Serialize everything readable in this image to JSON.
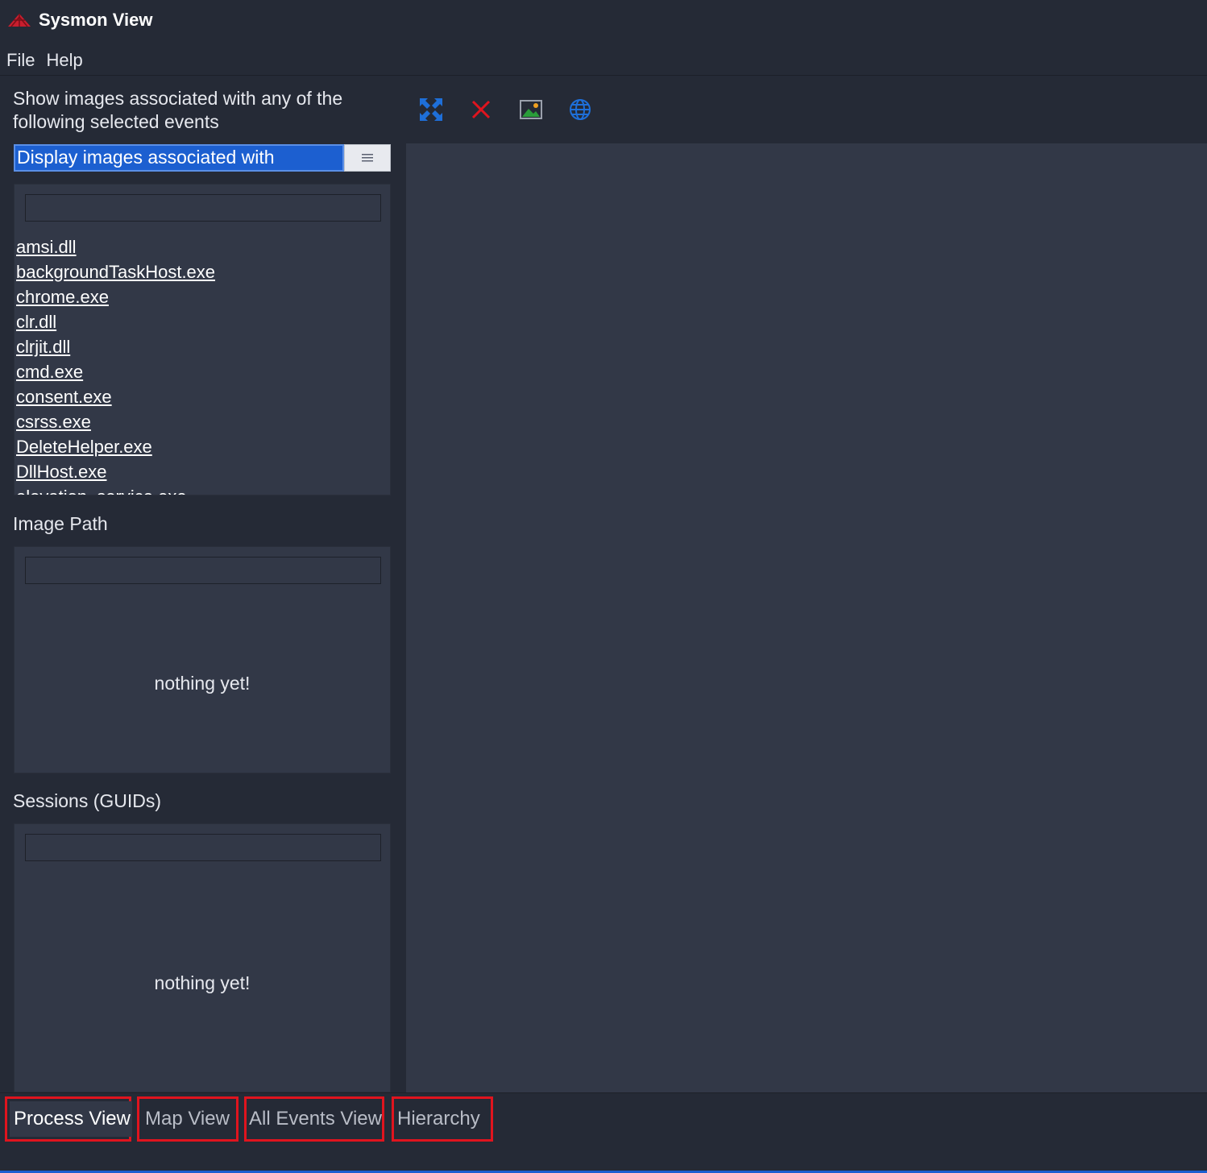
{
  "app": {
    "title": "Sysmon View"
  },
  "menu": {
    "items": [
      "File",
      "Help"
    ]
  },
  "left": {
    "events_title": "Show images associated with any of the following selected events",
    "event_select": {
      "value": "Display images associated with",
      "button_icon": "list-icon"
    },
    "images": [
      "amsi.dll",
      "backgroundTaskHost.exe",
      "chrome.exe",
      "clr.dll",
      "clrjit.dll",
      "cmd.exe",
      "consent.exe",
      "csrss.exe",
      "DeleteHelper.exe",
      "DllHost.exe",
      "elevation_service.exe"
    ],
    "image_path_title": "Image Path",
    "image_path_empty": "nothing yet!",
    "sessions_title": "Sessions (GUIDs)",
    "sessions_empty": "nothing yet!"
  },
  "toolbar": {
    "tools": [
      {
        "icon": "expand-arrows-icon",
        "color": "#1e6fd9"
      },
      {
        "icon": "close-icon",
        "color": "#e0141e"
      },
      {
        "icon": "image-icon",
        "color": "#2a9d3a"
      },
      {
        "icon": "globe-icon",
        "color": "#1e6fd9"
      }
    ]
  },
  "tabs": [
    {
      "label": "Process View",
      "active": true
    },
    {
      "label": "Map View",
      "active": false
    },
    {
      "label": "All Events View",
      "active": false
    },
    {
      "label": "Hierarchy",
      "active": false
    }
  ],
  "colors": {
    "accent": "#1c5fd0",
    "highlight": "#e0141e",
    "panel": "#323847",
    "background": "#252a36"
  }
}
